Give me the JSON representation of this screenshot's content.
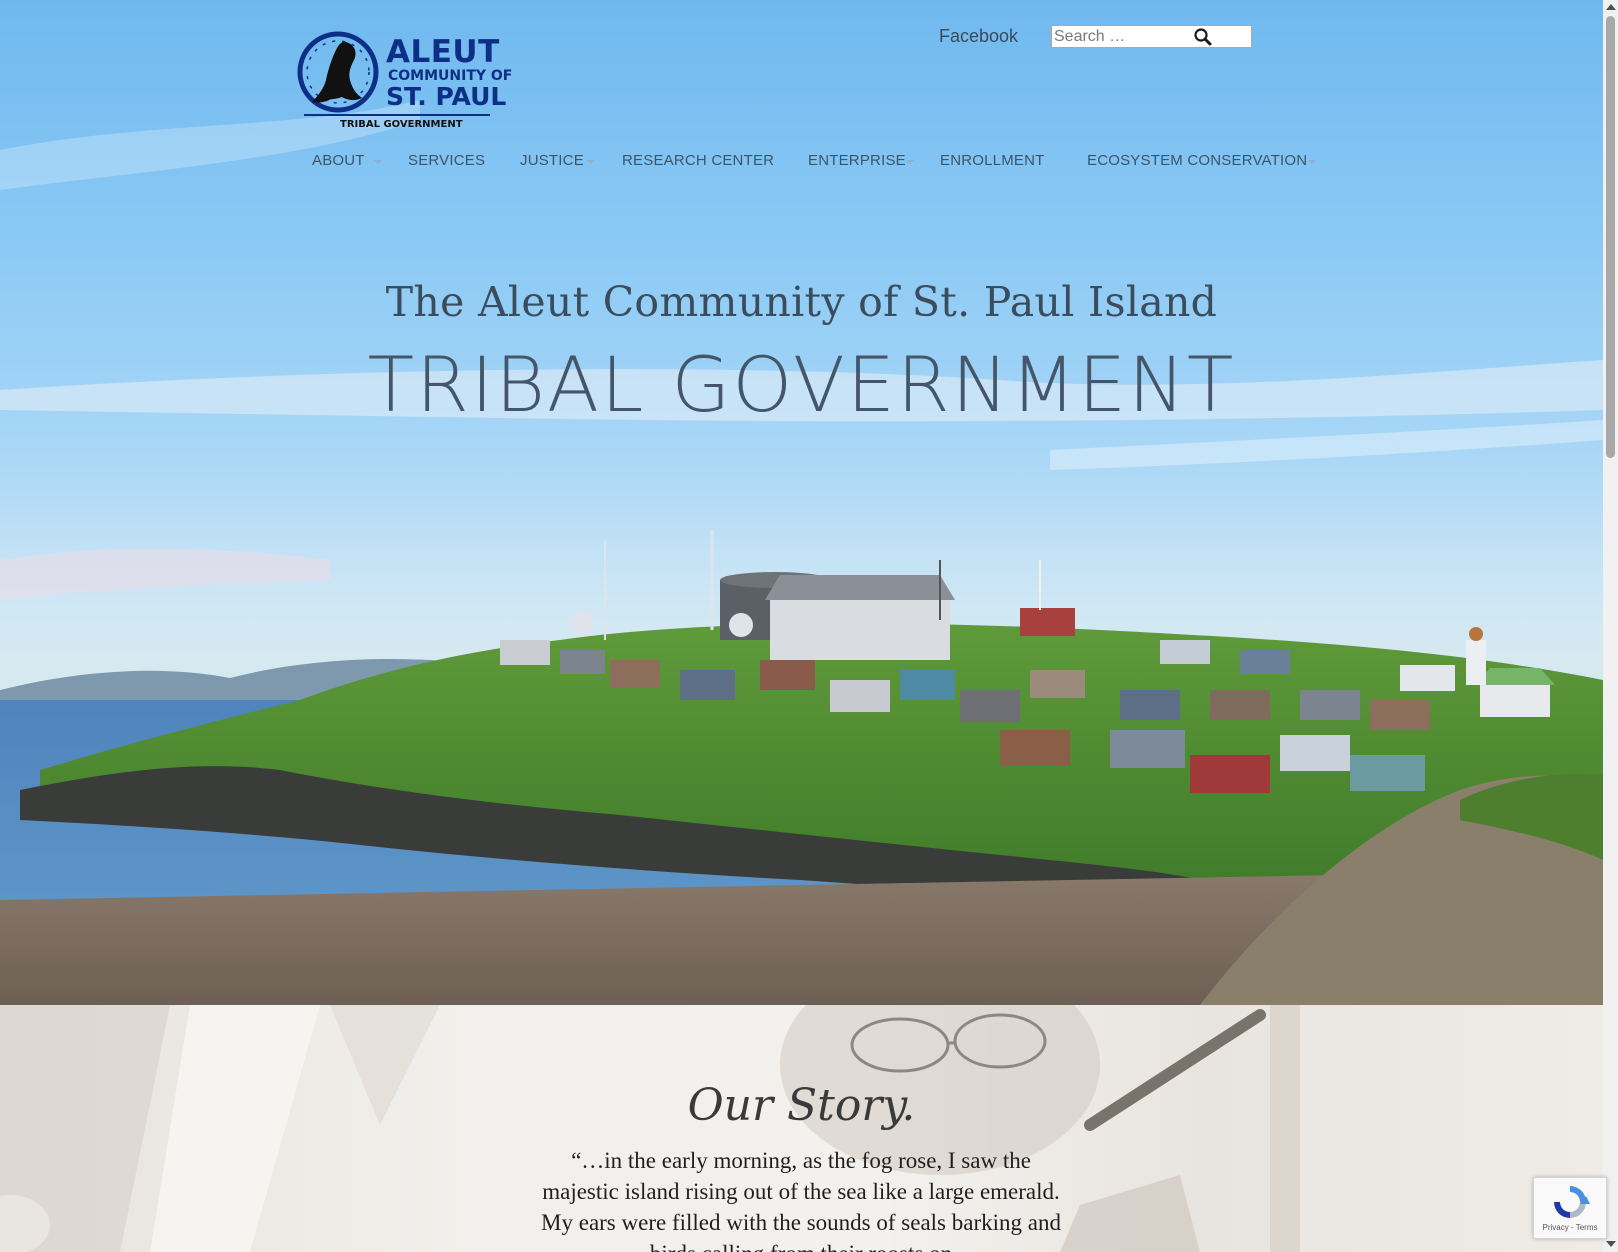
{
  "header": {
    "logo": {
      "line1": "ALEUT",
      "line2": "COMMUNITY OF",
      "line3": "ST. PAUL",
      "line4": "TRIBAL GOVERNMENT"
    },
    "facebook_label": "Facebook",
    "search": {
      "placeholder": "Search …",
      "value": "",
      "icon": "search-icon"
    }
  },
  "nav": {
    "items": [
      {
        "label": "ABOUT",
        "has_dropdown": true
      },
      {
        "label": "SERVICES",
        "has_dropdown": false
      },
      {
        "label": "JUSTICE",
        "has_dropdown": true
      },
      {
        "label": "RESEARCH CENTER",
        "has_dropdown": false
      },
      {
        "label": "ENTERPRISE",
        "has_dropdown": true
      },
      {
        "label": "ENROLLMENT",
        "has_dropdown": false
      },
      {
        "label": "ECOSYSTEM CONSERVATION",
        "has_dropdown": true
      }
    ]
  },
  "hero": {
    "subtitle": "The Aleut Community of St. Paul Island",
    "title": "TRIBAL GOVERNMENT"
  },
  "story": {
    "title": "Our Story.",
    "quote": "“…in the early morning, as the fog rose, I saw the majestic island rising out of the sea like a large emerald. My ears were filled with the sounds of seals barking and birds calling from their roosts on"
  },
  "recaptcha": {
    "links": "Privacy - Terms"
  },
  "colors": {
    "nav_text": "#3e5466",
    "logo_blue": "#0d2f86",
    "hero_title": "#45566a"
  }
}
